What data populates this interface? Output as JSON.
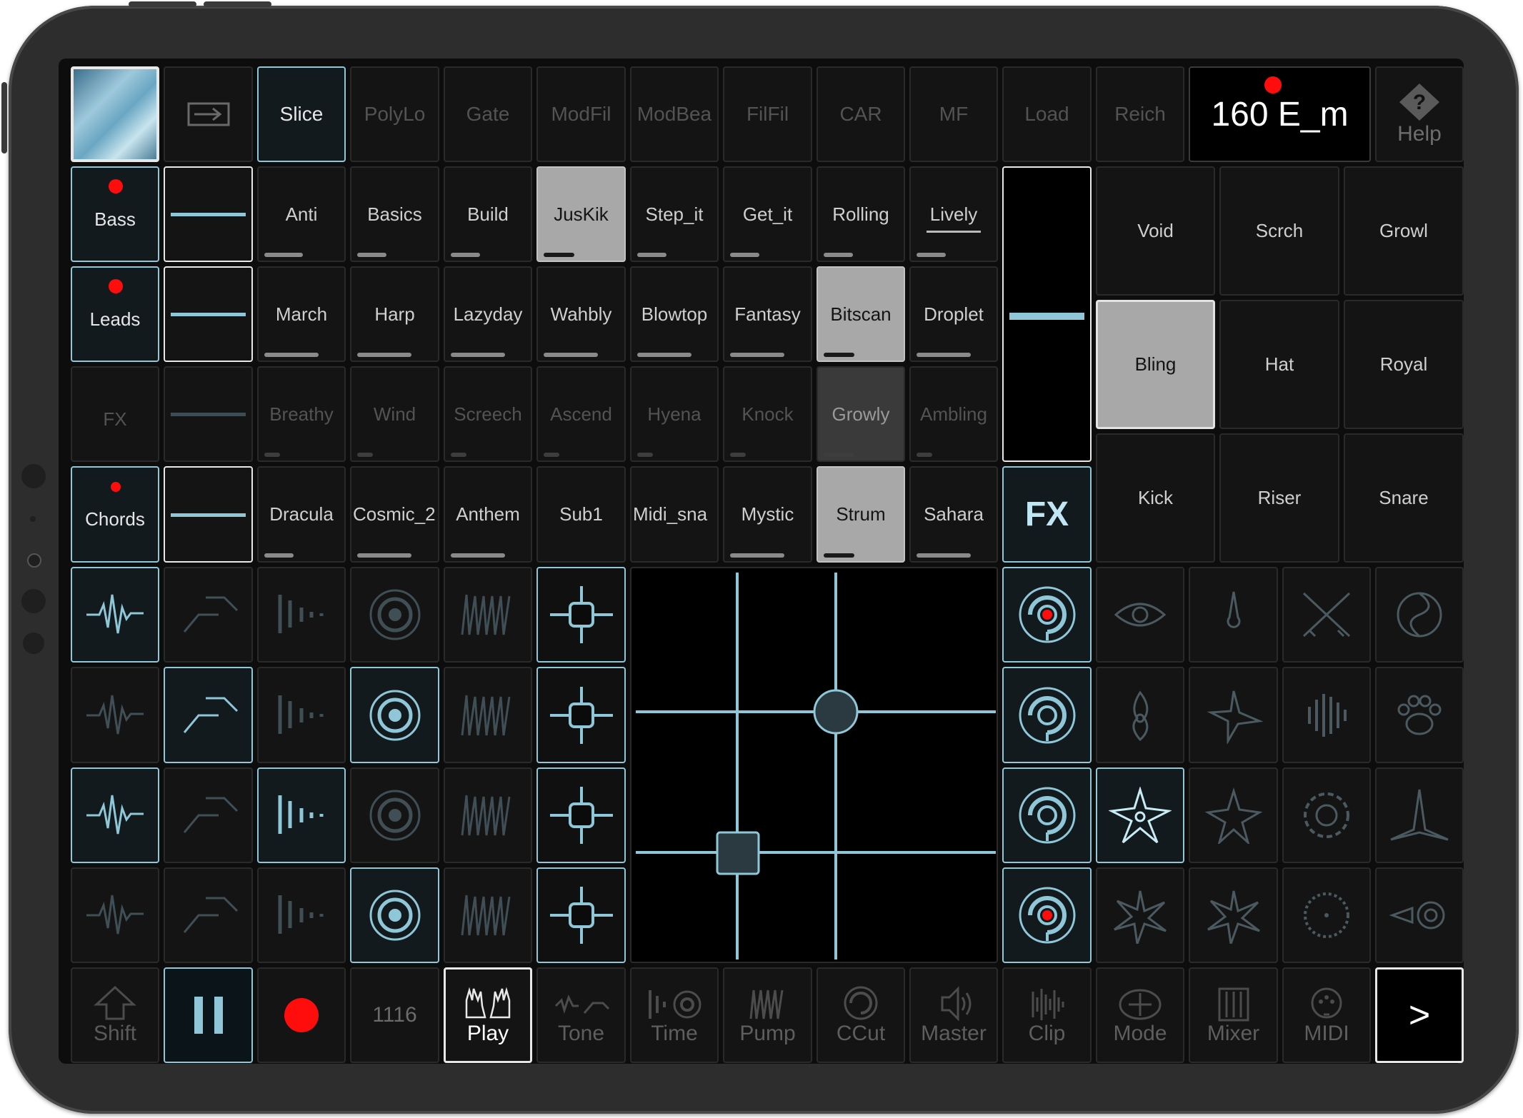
{
  "top_bar": {
    "tabs": [
      "Slice",
      "PolyLo",
      "Gate",
      "ModFil",
      "ModBea",
      "FilFil",
      "CAR",
      "MF",
      "Load",
      "Reich"
    ],
    "tempo_key": "160 E_m",
    "help_label": "Help"
  },
  "tracks": [
    {
      "name": "Bass",
      "recording": true
    },
    {
      "name": "Leads",
      "recording": true
    },
    {
      "name": "FX",
      "recording": false
    },
    {
      "name": "Chords",
      "recording": true
    }
  ],
  "clips": {
    "row_bass": [
      "Anti",
      "Basics",
      "Build",
      "JusKik",
      "Step_it",
      "Get_it",
      "Rolling",
      "Lively"
    ],
    "row_leads": [
      "March",
      "Harp",
      "Lazyday",
      "Wahbly",
      "Blowtop",
      "Fantasy",
      "Bitscan",
      "Droplet"
    ],
    "row_fx": [
      "Breathy",
      "Wind",
      "Screech",
      "Ascend",
      "Hyena",
      "Knock",
      "Growly",
      "Ambling"
    ],
    "row_chords": [
      "Dracula",
      "Cosmic_2",
      "Anthem",
      "Sub1",
      "Midi_sna",
      "Mystic",
      "Strum",
      "Sahara"
    ]
  },
  "fx_pads": [
    "Void",
    "Scrch",
    "Growl",
    "Bling",
    "Hat",
    "Royal",
    "Kick",
    "Riser",
    "Snare"
  ],
  "fx_button_label": "FX",
  "bottom_bar": {
    "shift": "Shift",
    "position": "1116",
    "play": "Play",
    "tone": "Tone",
    "time": "Time",
    "pump": "Pump",
    "ccut": "CCut",
    "master": "Master",
    "clip": "Clip",
    "mode": "Mode",
    "mixer": "Mixer",
    "midi": "MIDI",
    "next": ">"
  },
  "colors": {
    "accent": "#8fc7d9",
    "record": "#ff0d0d",
    "screen": "#0d0d0d",
    "cell": "#141414"
  },
  "icons": {
    "effect_columns": [
      "waveform-icon",
      "envelope-icon",
      "slicer-icon",
      "target-icon",
      "pump-icon",
      "crosshair-icon"
    ],
    "weapon_icons": [
      "eye-icon",
      "flame-drop-icon",
      "crossed-swords-icon",
      "shuriken-spiral-icon",
      "flame-icon",
      "throwing-star-icon",
      "bars-icon",
      "paw-icon",
      "throwing-star-4-icon",
      "throwing-star-5-icon",
      "gear-blade-icon",
      "kunai-star-icon",
      "pinwheel-icon",
      "pinwheel-2-icon",
      "saw-blade-icon",
      "key-blade-icon"
    ]
  }
}
